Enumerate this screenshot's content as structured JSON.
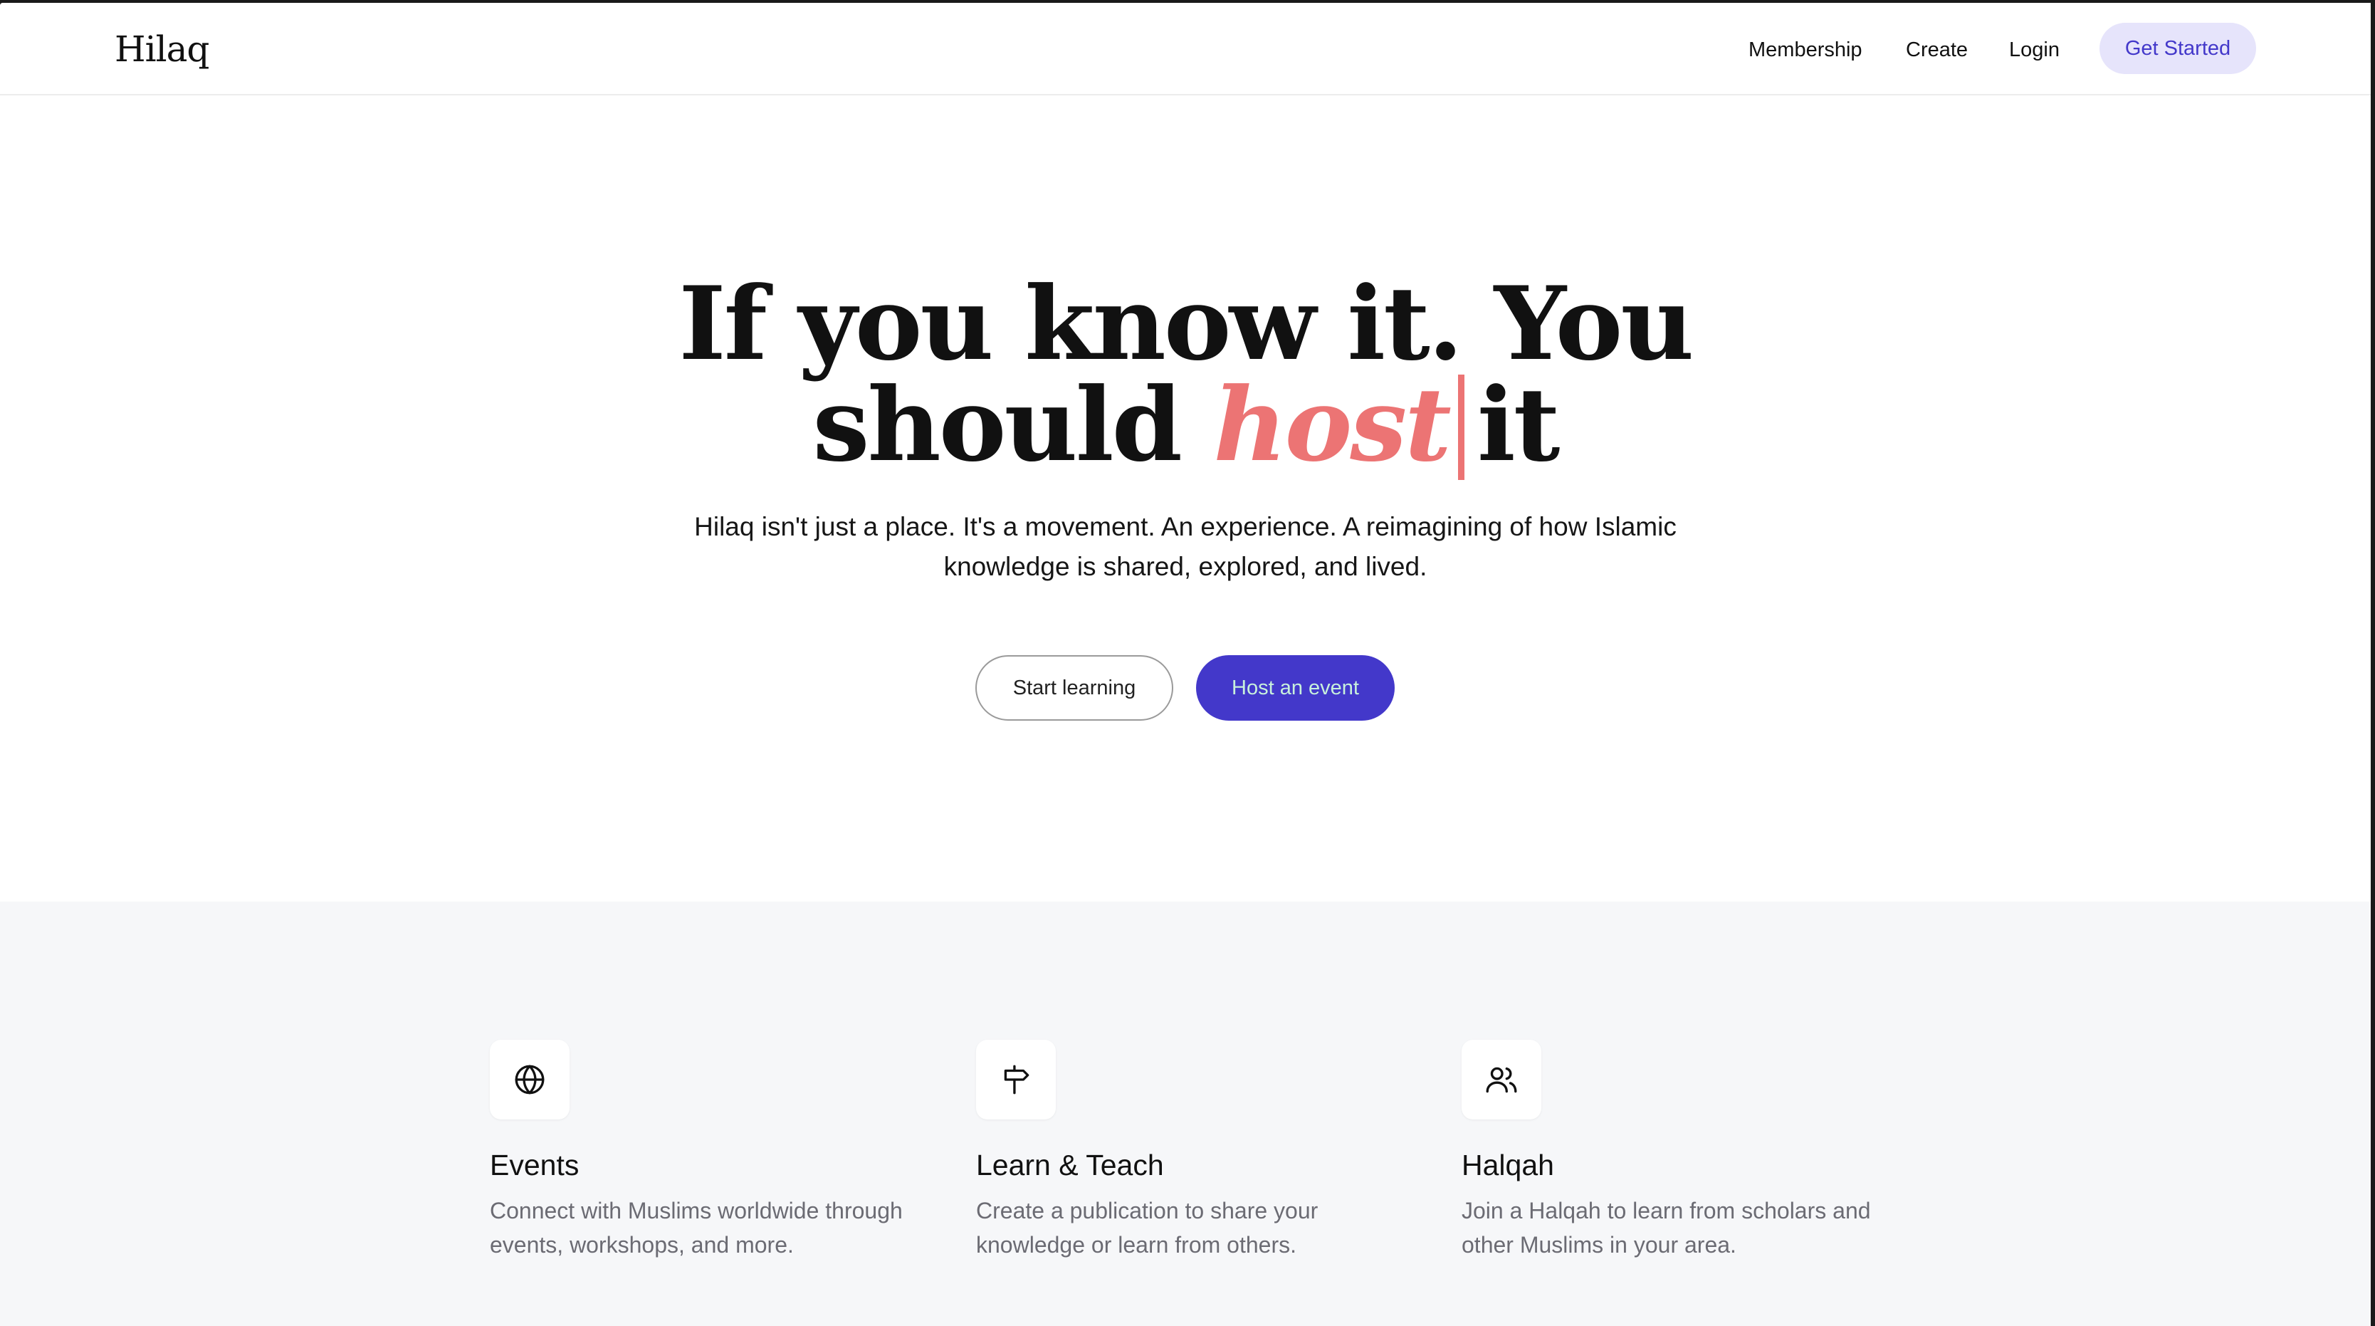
{
  "nav": {
    "logo": "Hilaq",
    "links": {
      "membership": "Membership",
      "create": "Create",
      "login": "Login"
    },
    "cta": "Get Started"
  },
  "hero": {
    "title_line1": "If you know it. You",
    "title_line2_before": "should",
    "title_accent": "host",
    "title_line2_after": "it",
    "subtitle": "Hilaq isn't just a place. It's a movement. An experience. A reimagining of how Islamic knowledge is shared, explored, and lived.",
    "buttons": {
      "secondary": "Start learning",
      "primary": "Host an event"
    }
  },
  "features": [
    {
      "icon": "globe-icon",
      "title": "Events",
      "description": "Connect with Muslims worldwide through events, workshops, and more."
    },
    {
      "icon": "signpost-icon",
      "title": "Learn & Teach",
      "description": "Create a publication to share your knowledge or learn from others."
    },
    {
      "icon": "users-icon",
      "title": "Halqah",
      "description": "Join a Halqah to learn from scholars and other Muslims in your area."
    }
  ],
  "colors": {
    "brand_primary": "#4338ca",
    "brand_primary_light": "#e6e4fb",
    "accent": "#ec7474",
    "text": "#111111",
    "muted_text": "#6b6b73",
    "section_bg": "#f6f7f9"
  }
}
